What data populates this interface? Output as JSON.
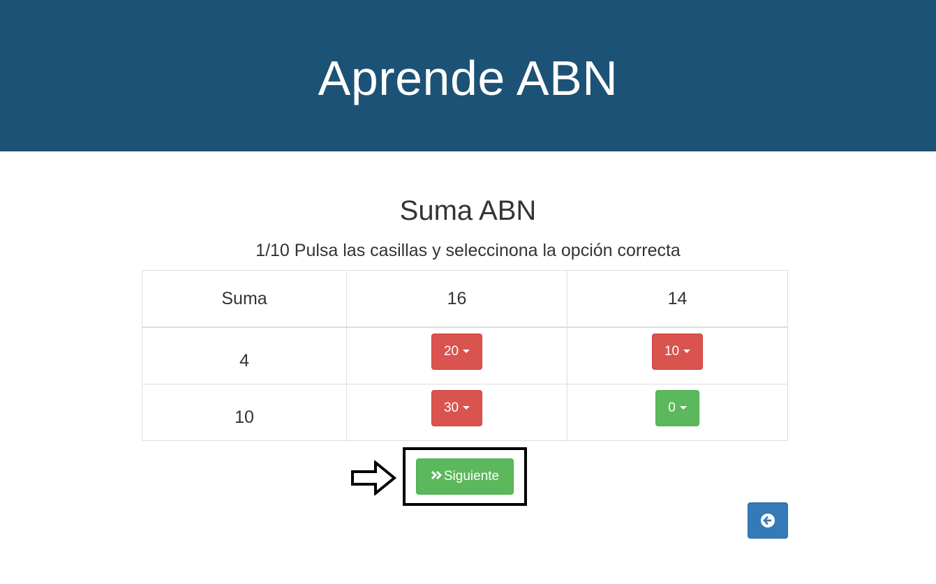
{
  "header": {
    "title": "Aprende ABN"
  },
  "main": {
    "subtitle": "Suma ABN",
    "instructions": "1/10 Pulsa las casillas y seleccinona la opción correcta",
    "table": {
      "header": [
        "Suma",
        "16",
        "14"
      ],
      "rows": [
        {
          "label": "4",
          "cells": [
            {
              "value": "20",
              "status": "incorrect",
              "color": "#d9534f"
            },
            {
              "value": "10",
              "status": "incorrect",
              "color": "#d9534f"
            }
          ]
        },
        {
          "label": "10",
          "cells": [
            {
              "value": "30",
              "status": "incorrect",
              "color": "#d9534f"
            },
            {
              "value": "0",
              "status": "correct",
              "color": "#5cb85c"
            }
          ]
        }
      ]
    },
    "next_button": {
      "label": "Siguiente",
      "icon": "double-chevron-right-icon"
    },
    "back_button": {
      "icon": "arrow-circle-left-icon"
    },
    "pointer_icon": "arrow-right-outline-icon"
  },
  "colors": {
    "header_bg": "#1c5276",
    "danger": "#d9534f",
    "success": "#5cb85c",
    "primary": "#337ab7"
  }
}
